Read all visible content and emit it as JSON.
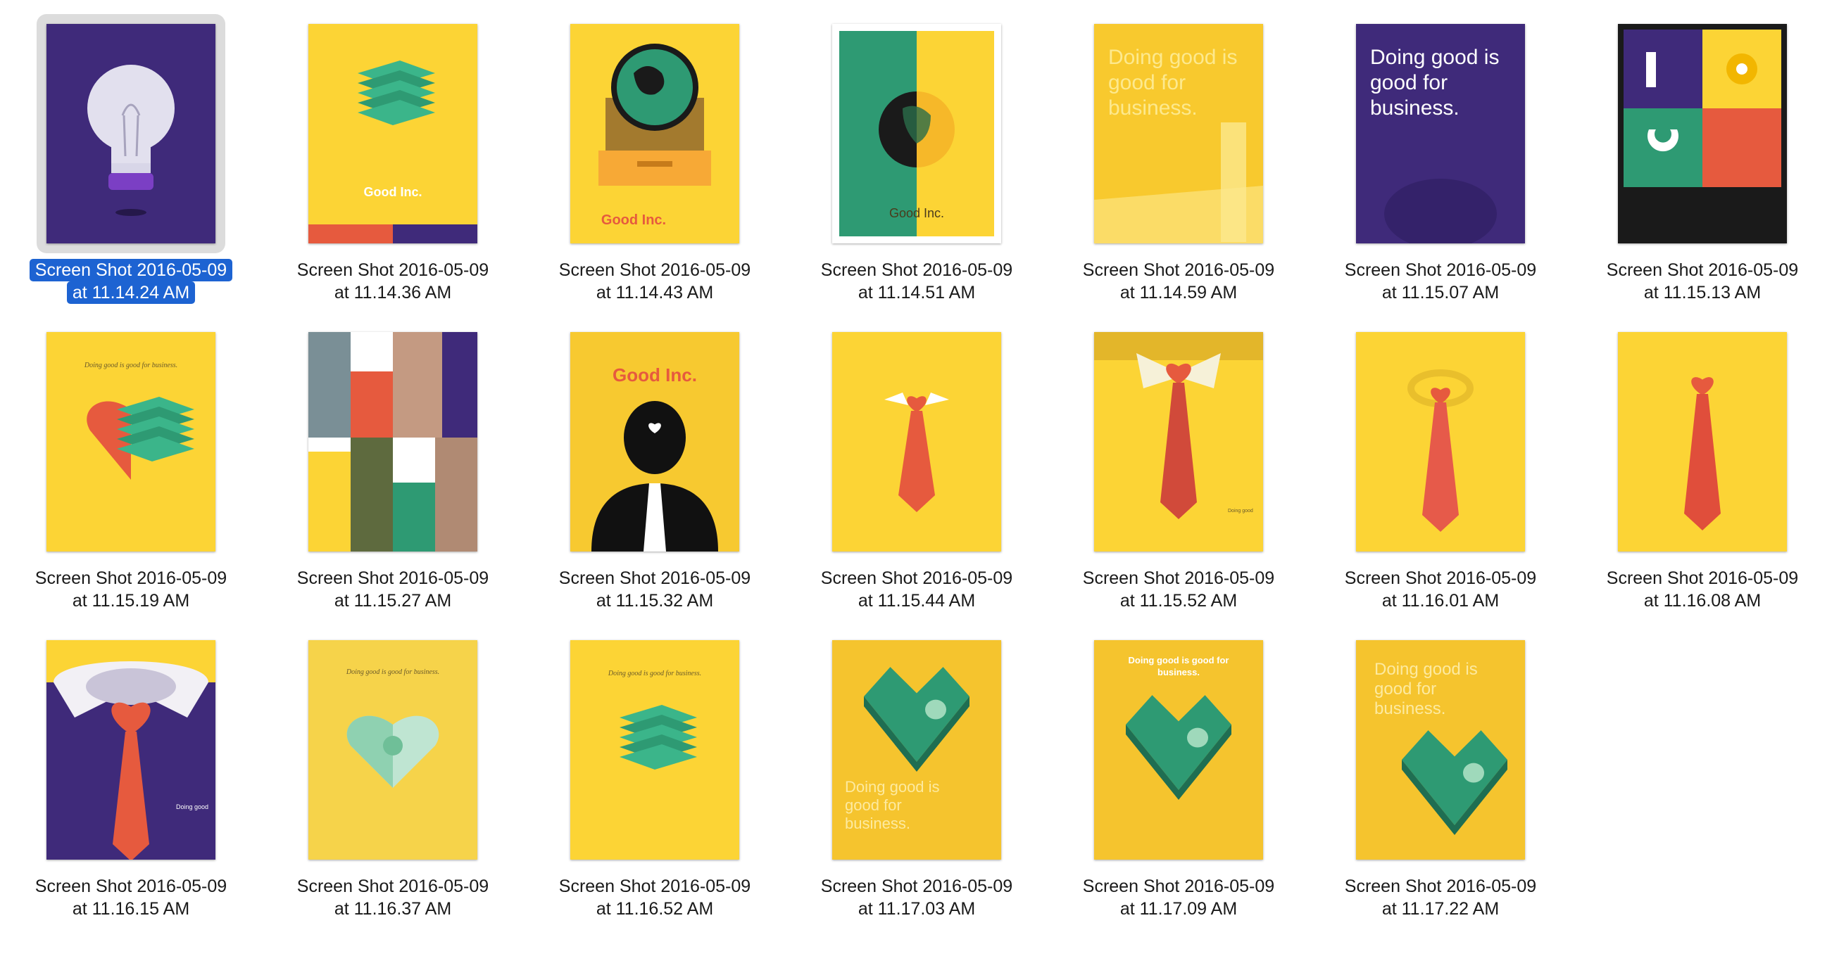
{
  "files": [
    {
      "line1": "Screen Shot 2016-05-09",
      "line2": "at 11.14.24 AM",
      "selected": true,
      "art": "lightbulb",
      "icon": "lightbulb-poster-icon"
    },
    {
      "line1": "Screen Shot 2016-05-09",
      "line2": "at 11.14.36 AM",
      "selected": false,
      "art": "money-stack",
      "icon": "money-stack-poster-icon",
      "text": "Good Inc."
    },
    {
      "line1": "Screen Shot 2016-05-09",
      "line2": "at 11.14.43 AM",
      "selected": false,
      "art": "globe-box",
      "icon": "globe-in-box-poster-icon",
      "text": "Good Inc."
    },
    {
      "line1": "Screen Shot 2016-05-09",
      "line2": "at 11.14.51 AM",
      "selected": false,
      "art": "globe-split",
      "icon": "split-globe-poster-icon",
      "text": "Good Inc."
    },
    {
      "line1": "Screen Shot 2016-05-09",
      "line2": "at 11.14.59 AM",
      "selected": false,
      "art": "text-yellow",
      "icon": "text-poster-icon",
      "text": "Doing good is good for business."
    },
    {
      "line1": "Screen Shot 2016-05-09",
      "line2": "at 11.15.07 AM",
      "selected": false,
      "art": "text-purple",
      "icon": "text-poster-icon",
      "text": "Doing good is good for business."
    },
    {
      "line1": "Screen Shot 2016-05-09",
      "line2": "at 11.15.13 AM",
      "selected": false,
      "art": "quad",
      "icon": "quad-grid-poster-icon"
    },
    {
      "line1": "Screen Shot 2016-05-09",
      "line2": "at 11.15.19 AM",
      "selected": false,
      "art": "heart-money",
      "icon": "heart-money-poster-icon",
      "text": "Doing good is good for business."
    },
    {
      "line1": "Screen Shot 2016-05-09",
      "line2": "at 11.15.27 AM",
      "selected": false,
      "art": "collage",
      "icon": "photo-collage-poster-icon"
    },
    {
      "line1": "Screen Shot 2016-05-09",
      "line2": "at 11.15.32 AM",
      "selected": false,
      "art": "silhouette",
      "icon": "silhouette-poster-icon",
      "text": "Good Inc."
    },
    {
      "line1": "Screen Shot 2016-05-09",
      "line2": "at 11.15.44 AM",
      "selected": false,
      "art": "tie-small",
      "icon": "tie-poster-icon"
    },
    {
      "line1": "Screen Shot 2016-05-09",
      "line2": "at 11.15.52 AM",
      "selected": false,
      "art": "tie-collar",
      "icon": "tie-collar-poster-icon"
    },
    {
      "line1": "Screen Shot 2016-05-09",
      "line2": "at 11.16.01 AM",
      "selected": false,
      "art": "tie-ring",
      "icon": "tie-poster-icon"
    },
    {
      "line1": "Screen Shot 2016-05-09",
      "line2": "at 11.16.08 AM",
      "selected": false,
      "art": "tie-plain",
      "icon": "tie-poster-icon"
    },
    {
      "line1": "Screen Shot 2016-05-09",
      "line2": "at 11.16.15 AM",
      "selected": false,
      "art": "tie-purple",
      "icon": "tie-collar-poster-icon"
    },
    {
      "line1": "Screen Shot 2016-05-09",
      "line2": "at 11.16.37 AM",
      "selected": false,
      "art": "heart-dollar",
      "icon": "dollar-heart-poster-icon",
      "text": "Doing good is good for business."
    },
    {
      "line1": "Screen Shot 2016-05-09",
      "line2": "at 11.16.52 AM",
      "selected": false,
      "art": "stack-lines",
      "icon": "money-stack-poster-icon",
      "text": "Doing good is good for business."
    },
    {
      "line1": "Screen Shot 2016-05-09",
      "line2": "at 11.17.03 AM",
      "selected": false,
      "art": "heart-bottom",
      "icon": "money-heart-poster-icon",
      "text": "Doing good is good for business."
    },
    {
      "line1": "Screen Shot 2016-05-09",
      "line2": "at 11.17.09 AM",
      "selected": false,
      "art": "heart-mid",
      "icon": "money-heart-poster-icon",
      "text": "Doing good is good for business."
    },
    {
      "line1": "Screen Shot 2016-05-09",
      "line2": "at 11.17.22 AM",
      "selected": false,
      "art": "heart-top",
      "icon": "money-heart-poster-icon",
      "text": "Doing good is good for business."
    }
  ],
  "colors": {
    "yellow": "#fcd435",
    "purple": "#3f2a7a",
    "green": "#2e9a73",
    "red": "#e65a3e",
    "selection": "#1d63d2"
  }
}
